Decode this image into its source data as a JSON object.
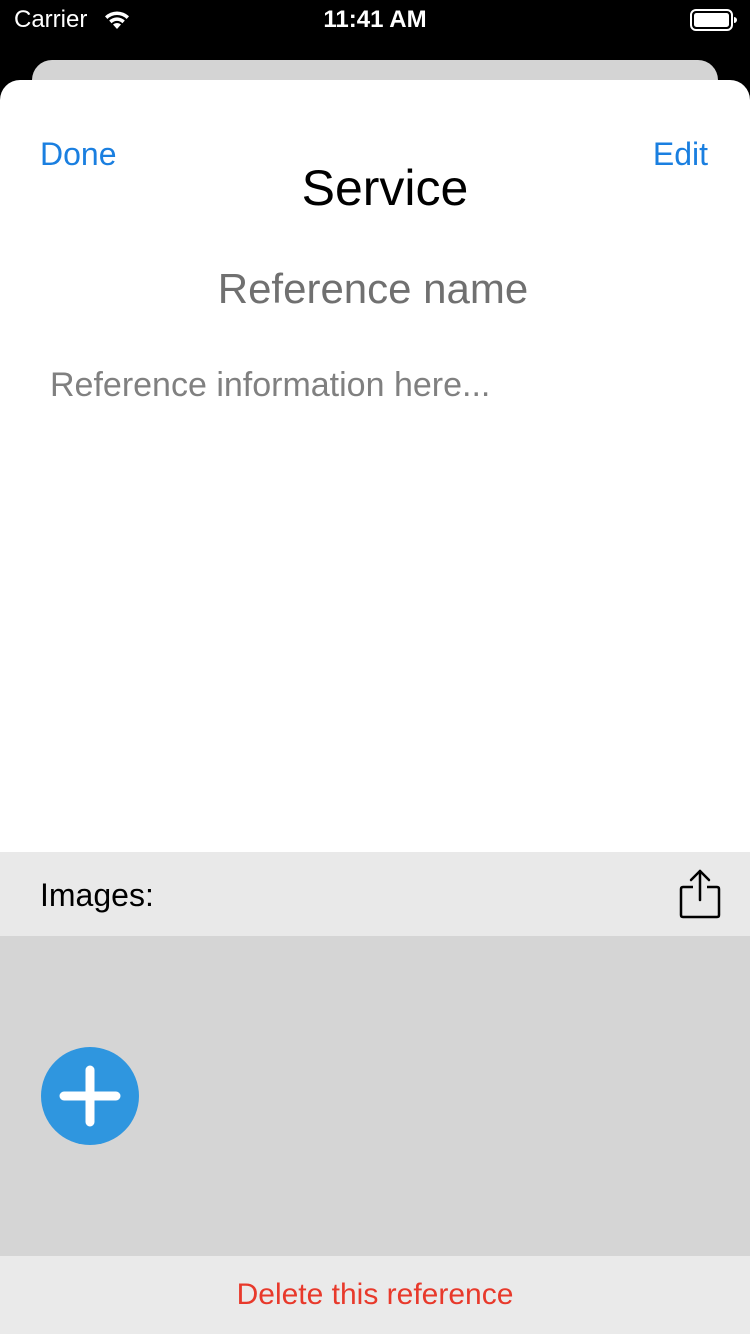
{
  "status_bar": {
    "carrier": "Carrier",
    "time": "11:41 AM",
    "wifi_icon": "wifi-icon",
    "battery_icon": "battery-icon"
  },
  "nav": {
    "done_label": "Done",
    "edit_label": "Edit",
    "title": "Service"
  },
  "reference": {
    "name_placeholder": "Reference name",
    "info_placeholder": "Reference information here..."
  },
  "images": {
    "label": "Images:",
    "share_icon": "share-icon",
    "add_icon": "add-circle-icon"
  },
  "actions": {
    "delete_label": "Delete this reference"
  },
  "colors": {
    "accent": "#1a7fe0",
    "destructive": "#e8392b",
    "add_button": "#2f96df"
  }
}
